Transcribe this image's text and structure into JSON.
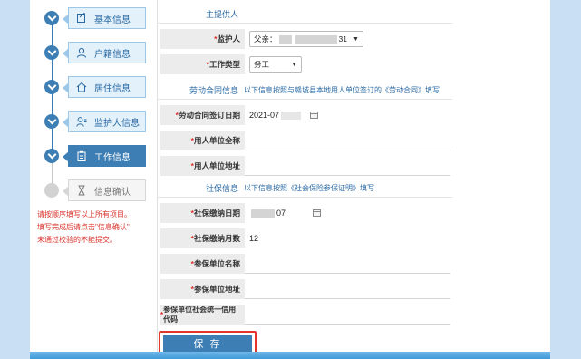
{
  "sidebar": {
    "steps": [
      {
        "label": "基本信息",
        "icon": "edit-icon"
      },
      {
        "label": "户籍信息",
        "icon": "person-icon"
      },
      {
        "label": "居住信息",
        "icon": "home-icon"
      },
      {
        "label": "监护人信息",
        "icon": "guardian-icon"
      },
      {
        "label": "工作信息",
        "icon": "clipboard-icon"
      },
      {
        "label": "信息确认",
        "icon": "hourglass-icon"
      }
    ],
    "hint": [
      "请按顺序填写以上所有项目。",
      "填写完成后请点击\"信息确认\"",
      "未通过校验的不能提交。"
    ]
  },
  "form": {
    "main_title": "主提供人",
    "guardian": {
      "label": "监护人",
      "value_prefix": "父亲：",
      "value_suffix": "31"
    },
    "work_type": {
      "label": "工作类型",
      "value": "务工"
    },
    "contract_section": {
      "title": "劳动合同信息",
      "desc": "以下信息按照与赣城县本地用人单位签订的《劳动合同》填写"
    },
    "contract_date": {
      "label": "劳动合同签订日期",
      "value": "2021-07"
    },
    "employer_name": {
      "label": "用人单位全称",
      "value": ""
    },
    "employer_address": {
      "label": "用人单位地址",
      "value": ""
    },
    "social_section": {
      "title": "社保信息",
      "desc": "以下信息按照《社会保险参保证明》填写"
    },
    "pay_date": {
      "label": "社保缴纳日期",
      "value": "07"
    },
    "pay_months": {
      "label": "社保缴纳月数",
      "value": "12"
    },
    "insured_name": {
      "label": "参保单位名称",
      "value": ""
    },
    "insured_address": {
      "label": "参保单位地址",
      "value": ""
    },
    "credit_code": {
      "label": "参保单位社会统一信用代码",
      "value": ""
    },
    "save_label": "保 存"
  },
  "colors": {
    "accent": "#3d7eb4",
    "required": "#d9322b",
    "highlight_border": "#e0372a"
  }
}
